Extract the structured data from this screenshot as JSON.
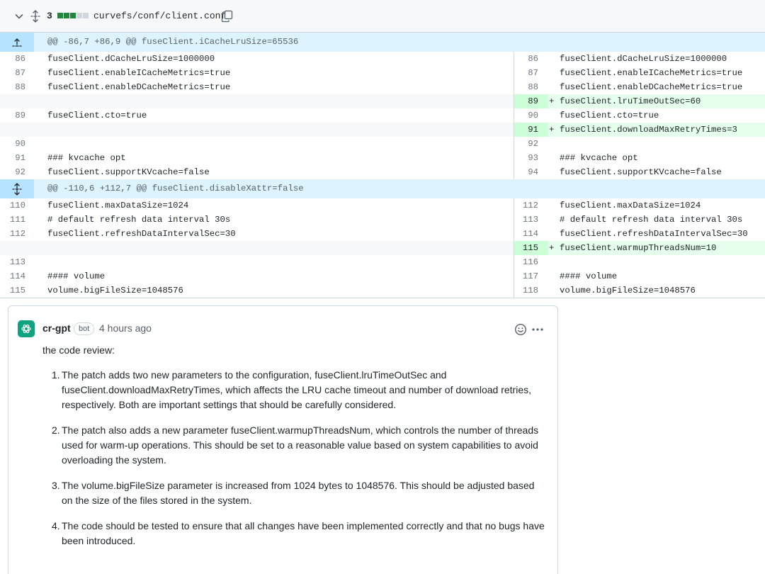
{
  "file": {
    "change_count": "3",
    "diffstat": [
      "add",
      "add",
      "add",
      "neutral",
      "neutral"
    ],
    "path": "curvefs/conf/client.conf"
  },
  "colors": {
    "add_block": "#1f883d",
    "neutral_block": "#d0d7de",
    "hunk_bg": "#ddf4ff",
    "added_bg": "#e6ffec",
    "avatar_bg": "#10a37f"
  },
  "diff": {
    "hunk1": "@@ -86,7 +86,9 @@ fuseClient.iCacheLruSize=65536",
    "rows1": [
      {
        "l": "86",
        "lc": "fuseClient.dCacheLruSize=1000000",
        "r": "86",
        "rc": "fuseClient.dCacheLruSize=1000000"
      },
      {
        "l": "87",
        "lc": "fuseClient.enableICacheMetrics=true",
        "r": "87",
        "rc": "fuseClient.enableICacheMetrics=true"
      },
      {
        "l": "88",
        "lc": "fuseClient.enableDCacheMetrics=true",
        "r": "88",
        "rc": "fuseClient.enableDCacheMetrics=true"
      },
      {
        "l": "",
        "lc": "",
        "r": "89",
        "sign": "+",
        "rc": "fuseClient.lruTimeOutSec=60"
      },
      {
        "l": "89",
        "lc": "fuseClient.cto=true",
        "r": "90",
        "rc": "fuseClient.cto=true"
      },
      {
        "l": "",
        "lc": "",
        "r": "91",
        "sign": "+",
        "rc": "fuseClient.downloadMaxRetryTimes=3"
      },
      {
        "l": "90",
        "lc": "",
        "r": "92",
        "rc": ""
      },
      {
        "l": "91",
        "lc": "### kvcache opt",
        "r": "93",
        "rc": "### kvcache opt"
      },
      {
        "l": "92",
        "lc": "fuseClient.supportKVcache=false",
        "r": "94",
        "rc": "fuseClient.supportKVcache=false"
      }
    ],
    "hunk2": "@@ -110,6 +112,7 @@ fuseClient.disableXattr=false",
    "rows2": [
      {
        "l": "110",
        "lc": "fuseClient.maxDataSize=1024",
        "r": "112",
        "rc": "fuseClient.maxDataSize=1024"
      },
      {
        "l": "111",
        "lc": "# default refresh data interval 30s",
        "r": "113",
        "rc": "# default refresh data interval 30s"
      },
      {
        "l": "112",
        "lc": "fuseClient.refreshDataIntervalSec=30",
        "r": "114",
        "rc": "fuseClient.refreshDataIntervalSec=30"
      },
      {
        "l": "",
        "lc": "",
        "r": "115",
        "sign": "+",
        "rc": "fuseClient.warmupThreadsNum=10"
      },
      {
        "l": "113",
        "lc": "",
        "r": "116",
        "rc": ""
      },
      {
        "l": "114",
        "lc": "#### volume",
        "r": "117",
        "rc": "#### volume"
      },
      {
        "l": "115",
        "lc": "volume.bigFileSize=1048576",
        "r": "118",
        "rc": "volume.bigFileSize=1048576"
      }
    ]
  },
  "comment": {
    "author": "cr-gpt",
    "badge": "bot",
    "time": "4 hours ago",
    "intro": "the code review:",
    "items": [
      {
        "num": "1.",
        "text": "The patch adds two new parameters to the configuration, fuseClient.lruTimeOutSec and fuseClient.downloadMaxRetryTimes, which affects the LRU cache timeout and number of download retries, respectively. Both are important settings that should be carefully considered."
      },
      {
        "num": "2.",
        "text": "The patch also adds a new parameter fuseClient.warmupThreadsNum, which controls the number of threads used for warm-up operations. This should be set to a reasonable value based on system capabilities to avoid overloading the system."
      },
      {
        "num": "3.",
        "text": "The volume.bigFileSize parameter is increased from 1024 bytes to 1048576. This should be adjusted based on the size of the files stored in the system."
      },
      {
        "num": "4.",
        "text": "The code should be tested to ensure that all changes have been implemented correctly and that no bugs have been introduced."
      }
    ]
  }
}
